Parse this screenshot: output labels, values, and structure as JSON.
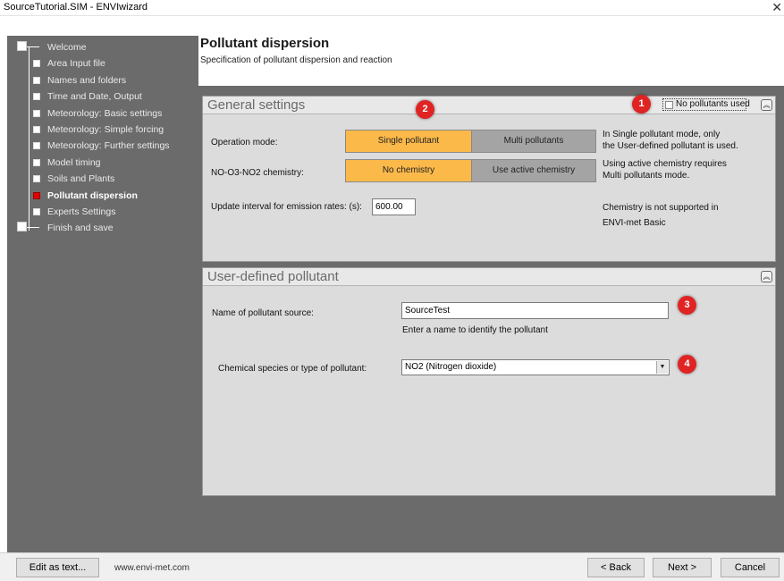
{
  "window": {
    "title": "SourceTutorial.SIM - ENVIwizard",
    "close_label": "✕"
  },
  "nav": {
    "items": [
      {
        "label": "Welcome",
        "active": false
      },
      {
        "label": "Area Input file",
        "active": false
      },
      {
        "label": "Names and folders",
        "active": false
      },
      {
        "label": "Time and Date, Output",
        "active": false
      },
      {
        "label": "Meteorology: Basic settings",
        "active": false
      },
      {
        "label": "Meteorology: Simple forcing",
        "active": false
      },
      {
        "label": "Meteorology: Further settings",
        "active": false
      },
      {
        "label": "Model timing",
        "active": false
      },
      {
        "label": "Soils and Plants",
        "active": false
      },
      {
        "label": "Pollutant dispersion",
        "active": true
      },
      {
        "label": "Experts Settings",
        "active": false
      },
      {
        "label": "Finish and save",
        "active": false
      }
    ]
  },
  "header": {
    "title": "Pollutant dispersion",
    "subtitle": "Specification of pollutant dispersion and reaction"
  },
  "general": {
    "title": "General settings",
    "no_pollutants_label": "No pollutants used",
    "collapse_icon": "chevron-up-icon",
    "operation_mode_label": "Operation mode:",
    "single_label": "Single pollutant",
    "multi_label": "Multi pollutants",
    "chemistry_label": "NO-O3-NO2 chemistry:",
    "no_chem_label": "No chemistry",
    "active_chem_label": "Use active chemistry",
    "update_label": "Update interval for emission rates: (s):",
    "update_value": "600.00",
    "info1_line1": "In Single pollutant mode, only",
    "info1_line2": "the User-defined pollutant is used.",
    "info2_line1": "Using active chemistry requires",
    "info2_line2": "Multi pollutants mode.",
    "info3_line1": "Chemistry is not supported in",
    "info3_line2": "ENVI-met Basic"
  },
  "user_pollutant": {
    "title": "User-defined pollutant",
    "name_label": "Name of pollutant source:",
    "name_value": "SourceTest",
    "name_hint": "Enter a name to identify the pollutant",
    "species_label": "Chemical species or type of pollutant:",
    "species_value": "NO2 (Nitrogen dioxide)"
  },
  "badges": {
    "b1": "1",
    "b2": "2",
    "b3": "3",
    "b4": "4"
  },
  "footer": {
    "edit_label": "Edit as text...",
    "url": "www.envi-met.com",
    "back_label": "< Back",
    "next_label": "Next >",
    "cancel_label": "Cancel"
  },
  "colors": {
    "accent_orange": "#fbb94a",
    "badge_red": "#e02424",
    "active_node": "#e00000"
  }
}
